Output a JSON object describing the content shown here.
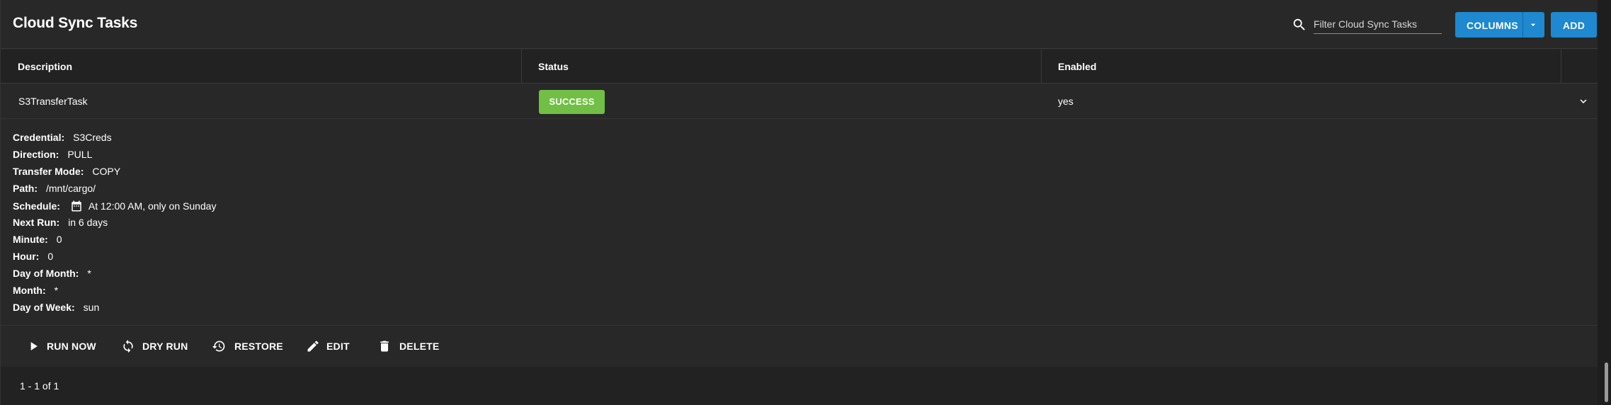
{
  "header": {
    "title": "Cloud Sync Tasks",
    "search_placeholder": "Filter Cloud Sync Tasks",
    "search_value": "",
    "columns_label": "COLUMNS",
    "add_label": "ADD"
  },
  "table": {
    "columns": [
      "Description",
      "Status",
      "Enabled"
    ],
    "rows": [
      {
        "description": "S3TransferTask",
        "status": "SUCCESS",
        "enabled": "yes"
      }
    ]
  },
  "detail": {
    "fields": [
      {
        "label": "Credential:",
        "value": "S3Creds"
      },
      {
        "label": "Direction:",
        "value": "PULL"
      },
      {
        "label": "Transfer Mode:",
        "value": "COPY"
      },
      {
        "label": "Path:",
        "value": "/mnt/cargo/"
      },
      {
        "label": "Schedule:",
        "value": "At 12:00 AM, only on Sunday"
      },
      {
        "label": "Next Run:",
        "value": "in 6 days"
      },
      {
        "label": "Minute:",
        "value": "0"
      },
      {
        "label": "Hour:",
        "value": "0"
      },
      {
        "label": "Day of Month:",
        "value": "*"
      },
      {
        "label": "Month:",
        "value": "*"
      },
      {
        "label": "Day of Week:",
        "value": "sun"
      }
    ],
    "schedule_icon": "calendar-icon"
  },
  "actions": [
    {
      "label": "RUN NOW",
      "icon": "play-icon"
    },
    {
      "label": "DRY RUN",
      "icon": "sync-icon"
    },
    {
      "label": "RESTORE",
      "icon": "history-icon"
    },
    {
      "label": "EDIT",
      "icon": "pencil-icon"
    },
    {
      "label": "DELETE",
      "icon": "trash-icon"
    }
  ],
  "footer": {
    "range_label": "1 - 1 of 1"
  },
  "colors": {
    "primary": "#1e88d0",
    "success": "#71bf44",
    "background": "#282828"
  }
}
